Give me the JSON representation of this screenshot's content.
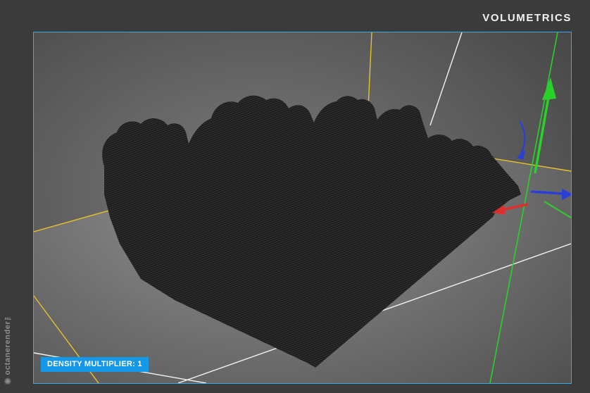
{
  "header": {
    "title": "VOLUMETRICS"
  },
  "brand": {
    "name": "octanerender",
    "tm": "™",
    "logo_glyph": "✺"
  },
  "viewport": {
    "density_badge": "DENSITY MULTIPLIER: 1"
  },
  "icons": {
    "logo": "octane-logo-icon"
  },
  "colors": {
    "frame_bg": "#3b3b3b",
    "title_text": "#f2f2f2",
    "brand_text": "#8e8e8e",
    "viewport_border": "#38a8e8",
    "viewport_bg_center": "#959595",
    "viewport_bg_edge": "#525252",
    "badge_bg": "#1598e8",
    "badge_text": "#ffffff",
    "axis_yellow": "#e6c428",
    "axis_green": "#2bd12b",
    "axis_blue": "#2b3fd8",
    "axis_red": "#de2f2f",
    "grid_white": "#f2f2f2",
    "mesh_dark": "#131313"
  }
}
